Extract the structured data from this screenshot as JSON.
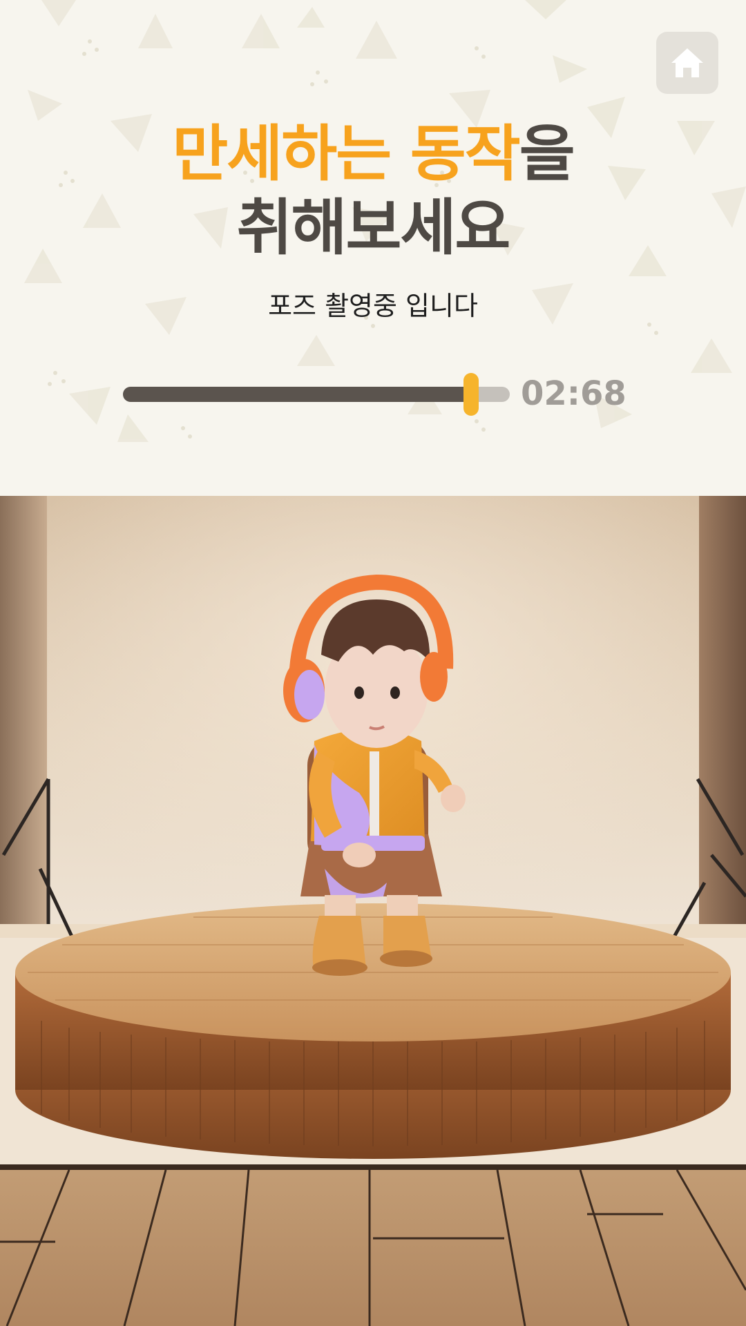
{
  "header": {
    "instruction_line1_highlight1": "만세하는",
    "instruction_line1_highlight2": "동작",
    "instruction_line1_suffix": "을",
    "instruction_line2": "취해보세요"
  },
  "status": {
    "message": "포즈 촬영중 입니다"
  },
  "recording": {
    "progress": 0.9,
    "timer": "02:68"
  },
  "icons": {
    "home": "home-icon"
  },
  "colors": {
    "accent_orange": "#f7a21d",
    "text_dark": "#4e4944",
    "handle_yellow": "#f6b42c",
    "track_fill": "#5b544e",
    "panel_bg": "#f7f5ee"
  }
}
